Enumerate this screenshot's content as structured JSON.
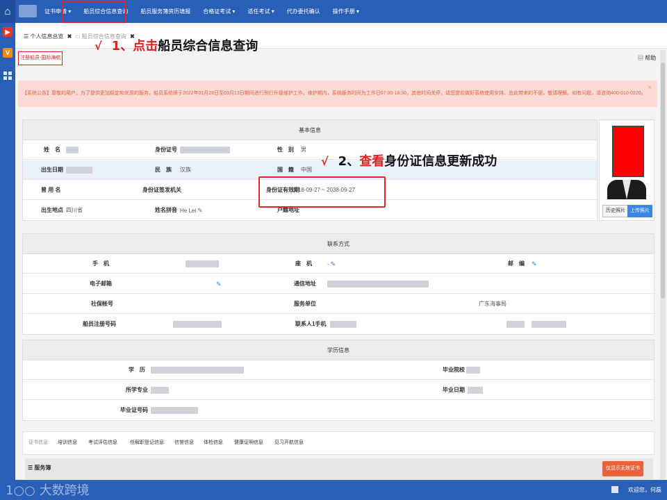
{
  "topbar": {
    "nav": [
      "证书申请 ▾",
      "船员综合信息查询",
      "船员服务簿资历填报",
      "合格证考试 ▾",
      "适任考试 ▾",
      "代办委托确认",
      "操作手册 ▾"
    ]
  },
  "tabs": [
    {
      "label": "个人信息总览",
      "close": "✖"
    },
    {
      "label": "船员综合信息查询",
      "close": "✖"
    }
  ],
  "breadcrumb": "注册船员-国际海航",
  "help": "帮助",
  "annotations": {
    "step1_check": "√",
    "step1_prefix": "1、",
    "step1_verb": "点击",
    "step1_text": "船员综合信息查询",
    "step2_check": "√",
    "step2_prefix": "2、",
    "step2_verb": "查看",
    "step2_text": "身份证信息更新成功"
  },
  "notice": "【系统公告】尊敬的用户，为了提供更加稳定和优质的服务，船员系统将于2022年01月28日至03月13日期间进行例行升级维护工作。维护期内，系统服务时间为工作日07:00-18:30，其他时间关停，请您提前做好系统使用安排。由此带来的不便，敬请理解。如有问题，请咨询400-010-0220。",
  "notice_close": "×",
  "basic": {
    "title": "基本信息",
    "rows": [
      [
        {
          "l": "姓　名"
        },
        {
          "v": ""
        },
        {
          "l": "身份证号"
        },
        {
          "v": ""
        },
        {
          "l": "性　别"
        },
        {
          "v": "男"
        }
      ],
      [
        {
          "l": "出生日期"
        },
        {
          "v": ""
        },
        {
          "l": "民　族"
        },
        {
          "v": "汉族"
        },
        {
          "l": "国　籍"
        },
        {
          "v": "中国"
        }
      ],
      [
        {
          "l": "曾 用 名"
        },
        {
          "v": ""
        },
        {
          "l": "身份证签发机关"
        },
        {
          "v": ""
        },
        {
          "l": "身份证有效期"
        },
        {
          "v": "2018-09-27 ~ 2038-09-27"
        }
      ],
      [
        {
          "l": "出生地点"
        },
        {
          "v": "四川省"
        },
        {
          "l": "姓名拼音"
        },
        {
          "v": "He Lei"
        },
        {
          "l": "户籍地址"
        },
        {
          "v": ""
        }
      ]
    ],
    "btn_history": "历史照片",
    "btn_upload": "上传照片"
  },
  "contact": {
    "title": "联系方式",
    "labels": [
      "手　机",
      "座　机",
      "邮　编",
      "电子邮箱",
      "通信地址",
      "社保帐号",
      "服务单位",
      "船员注册号码",
      "联系人1手机"
    ],
    "landline_value": "-",
    "work_unit": "广东海事局"
  },
  "education": {
    "title": "学历信息",
    "labels": [
      "学　历",
      "毕业院校",
      "所学专业",
      "毕业日期",
      "毕业证号码"
    ]
  },
  "lower_tabs": [
    "证书信息",
    "培训信息",
    "考试评估信息",
    "任解职登记信息",
    "信誉信息",
    "体检信息",
    "健康证明信息",
    "见习开航信息"
  ],
  "service_section": "服务簿",
  "btn_only_valid": "仅显示无效证书",
  "watermark": "1○○ 大数跨境",
  "status_right": "欢迎您，何磊"
}
